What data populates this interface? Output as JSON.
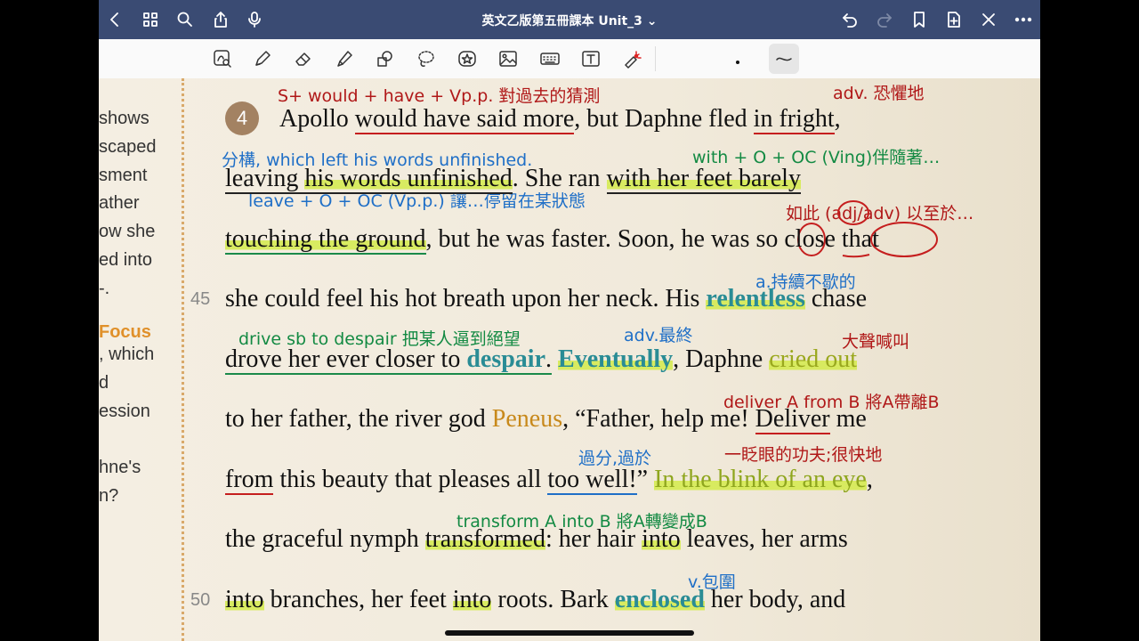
{
  "nav": {
    "title": "英文乙版第五冊課本 Unit_3 ⌄"
  },
  "sidebar": [
    "shows",
    "scaped",
    "sment",
    "ather",
    "ow she",
    "ed into",
    "-.",
    "Focus",
    ", which",
    "d",
    "ession",
    "hne's",
    "n?"
  ],
  "line_numbers": [
    "45",
    "50"
  ],
  "paragraph_number": "4",
  "line1": {
    "a": "Apollo ",
    "b": "would have said more",
    "c": ", but Daphne fled ",
    "d": "in fright",
    "e": ","
  },
  "line2": {
    "a": "leaving ",
    "b": "his words unfinished",
    "c": ". She ran ",
    "d": "with her feet barely"
  },
  "line3": {
    "a": "touching the ground",
    "b": ", but he was faster. Soon, he was ",
    "c": "so",
    "d": " ",
    "e": "close",
    "f": " ",
    "g": "that"
  },
  "line4": {
    "a": "she could feel his hot breath upon her neck. His ",
    "b": "relentless",
    "c": " chase"
  },
  "line5": {
    "a": "drove her ever closer to ",
    "b": "despair",
    "c": ".",
    "d": " ",
    "e": "Eventually",
    "f": ", Daphne ",
    "g": "cried out"
  },
  "line6": {
    "a": "to her father, the river god ",
    "b": "Peneus",
    "c": ", “Father, help me! ",
    "d": "Deliver",
    "e": " me"
  },
  "line7": {
    "a": "from",
    "b": " this beauty that pleases all ",
    "c": "too well!",
    "d": "” ",
    "e": "In the blink of an eye",
    "f": ","
  },
  "line8": {
    "a": "the graceful nymph ",
    "b": "transformed",
    "c": ": her hair ",
    "d": "into",
    "e": " leaves, her arms"
  },
  "line9": {
    "a": "into",
    "b": " branches, her feet ",
    "c": "into",
    "d": " roots. Bark ",
    "e": "enclosed",
    "f": " her body, and"
  },
  "annotations": {
    "a1": "S+ would + have + Vp.p. 對過去的猜測",
    "a2": "adv. 恐懼地",
    "a3": "分構, which left his words unfinished.",
    "a4": "with + O + OC (Ving)伴隨著…",
    "a5": "leave + O + OC (Vp.p.) 讓…停留在某狀態",
    "a6": "如此 (adj/adv) 以至於…",
    "a7": "a.持續不歇的",
    "a8": "drive sb to despair 把某人逼到絕望",
    "a9": "adv.最終",
    "a10": "大聲喊叫",
    "a11": "deliver A from B 將A帶離B",
    "a12": "過分,過於",
    "a13": "一眨眼的功夫;很快地",
    "a14": "transform A into B   將A轉變成B",
    "a15": "v.包圍"
  },
  "colors": {
    "nav": "#3a4b73",
    "red": "#b01818",
    "blue": "#1f6fc7",
    "green": "#138a43",
    "vocab": "#2a8c95",
    "highlight": "#d4eb4b"
  }
}
